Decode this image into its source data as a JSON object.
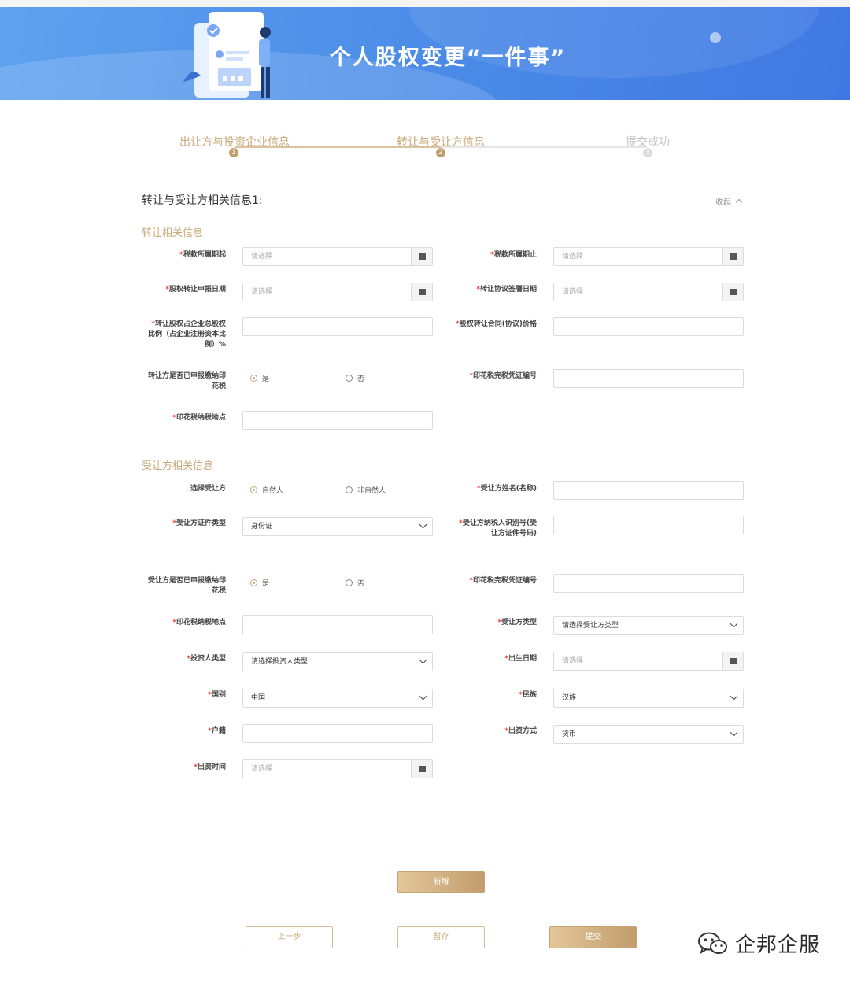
{
  "banner": {
    "title": "个人股权变更“一件事”"
  },
  "steps": [
    {
      "num": "1",
      "label": "出让方与投资企业信息"
    },
    {
      "num": "2",
      "label": "转让与受让方信息"
    },
    {
      "num": "3",
      "label": "提交成功"
    }
  ],
  "section": {
    "title": "转让与受让方相关信息1:",
    "collapse_label": "收起"
  },
  "transfer": {
    "title": "转让相关信息",
    "tax_period_start": {
      "label": "税款所属期起",
      "placeholder": "请选择"
    },
    "tax_period_end": {
      "label": "税款所属期止",
      "placeholder": "请选择"
    },
    "declare_date": {
      "label": "股权转让申报日期",
      "placeholder": "请选择"
    },
    "sign_date": {
      "label": "转让协议签署日期",
      "placeholder": "请选择"
    },
    "equity_ratio": {
      "label_lines": [
        "转让股权占企业总股权",
        "比例（占企业注册资本比",
        "例）%"
      ],
      "value": ""
    },
    "contract_price": {
      "label": "股权转让合同(协议)价格",
      "value": ""
    },
    "stamp_declared": {
      "label_lines": [
        "转让方是否已申报缴纳印",
        "花税"
      ],
      "options": [
        "是",
        "否"
      ],
      "selected": "是"
    },
    "stamp_voucher": {
      "label": "印花税完税凭证编号",
      "value": ""
    },
    "stamp_place": {
      "label": "印花税纳税地点",
      "value": ""
    }
  },
  "transferee": {
    "title": "受让方相关信息",
    "choose": {
      "label": "选择受让方",
      "options": [
        "自然人",
        "非自然人"
      ],
      "selected": "自然人"
    },
    "name": {
      "label": "受让方姓名(名称)",
      "value": ""
    },
    "id_type": {
      "label": "受让方证件类型",
      "value": "身份证"
    },
    "taxpayer_id": {
      "label_lines": [
        "受让方纳税人识别号(受",
        "让方证件号码)"
      ],
      "value": ""
    },
    "stamp_declared": {
      "label_lines": [
        "受让方是否已申报缴纳印",
        "花税"
      ],
      "options": [
        "是",
        "否"
      ],
      "selected": "是"
    },
    "stamp_voucher": {
      "label": "印花税完税凭证编号",
      "value": ""
    },
    "stamp_place": {
      "label": "印花税纳税地点",
      "value": ""
    },
    "transferee_type": {
      "label": "受让方类型",
      "value": "请选择受让方类型"
    },
    "investor_type": {
      "label": "投资人类型",
      "value": "请选择投资人类型"
    },
    "birth_date": {
      "label": "出生日期",
      "placeholder": "请选择"
    },
    "country": {
      "label": "国别",
      "value": "中国"
    },
    "ethnicity": {
      "label": "民族",
      "value": "汉族"
    },
    "household": {
      "label": "户籍",
      "value": ""
    },
    "contribution_method": {
      "label": "出资方式",
      "value": "货币"
    },
    "contribution_time": {
      "label": "出资时间",
      "placeholder": "请选择"
    }
  },
  "buttons": {
    "add": "新增",
    "prev": "上一步",
    "save": "暂存",
    "submit": "提交"
  },
  "watermark": {
    "text": "企邦企服"
  },
  "colors": {
    "accent": "#c9a877",
    "banner": "#4d8ee8",
    "required": "#e8453c"
  }
}
